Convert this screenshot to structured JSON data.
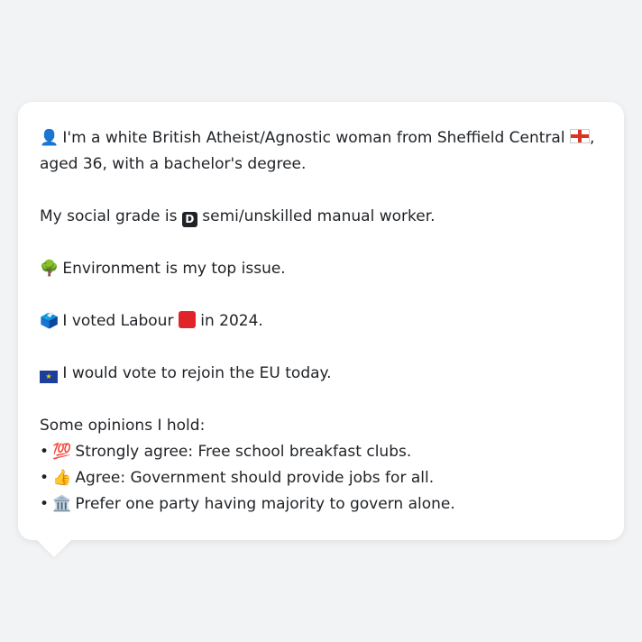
{
  "profile": {
    "intro_line1": "I'm a white British Atheist/Agnostic woman from Sheffield Central",
    "intro_comma": ",",
    "intro_line2": "aged 36, with a bachelor's degree.",
    "social_grade_prefix": "My social grade is",
    "social_grade_badge": "D",
    "social_grade_value": "semi/unskilled manual worker.",
    "top_issue": "Environment is my top issue.",
    "voted_prefix": "I voted Labour",
    "voted_suffix": "in 2024.",
    "eu_stance": "I would vote to rejoin the EU today.",
    "opinions_heading": "Some opinions I hold:",
    "opinions": [
      {
        "icon": "💯",
        "text": "Strongly agree: Free school breakfast clubs."
      },
      {
        "icon": "👍",
        "text": "Agree: Government should provide jobs for all."
      },
      {
        "icon": "🏛️",
        "text": "Prefer one party having majority to govern alone."
      }
    ]
  },
  "icons": {
    "person": "👤",
    "tree": "🌳",
    "ballot": "🗳️"
  },
  "colors": {
    "background": "#f2f3f5",
    "bubble": "#ffffff",
    "text": "#1f2226",
    "labour_red": "#e0242a"
  }
}
